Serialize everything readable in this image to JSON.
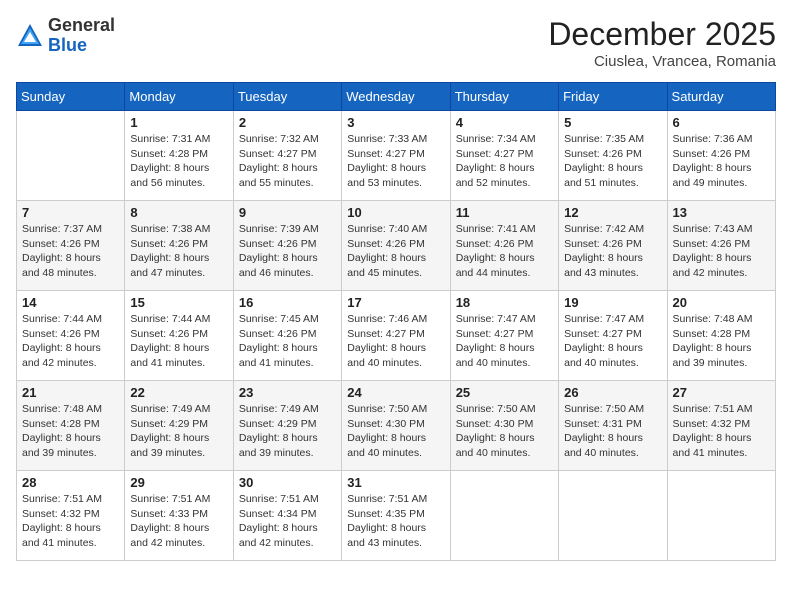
{
  "header": {
    "logo_general": "General",
    "logo_blue": "Blue",
    "month_title": "December 2025",
    "location": "Ciuslea, Vrancea, Romania"
  },
  "weekdays": [
    "Sunday",
    "Monday",
    "Tuesday",
    "Wednesday",
    "Thursday",
    "Friday",
    "Saturday"
  ],
  "weeks": [
    [
      {
        "day": "",
        "info": ""
      },
      {
        "day": "1",
        "info": "Sunrise: 7:31 AM\nSunset: 4:28 PM\nDaylight: 8 hours\nand 56 minutes."
      },
      {
        "day": "2",
        "info": "Sunrise: 7:32 AM\nSunset: 4:27 PM\nDaylight: 8 hours\nand 55 minutes."
      },
      {
        "day": "3",
        "info": "Sunrise: 7:33 AM\nSunset: 4:27 PM\nDaylight: 8 hours\nand 53 minutes."
      },
      {
        "day": "4",
        "info": "Sunrise: 7:34 AM\nSunset: 4:27 PM\nDaylight: 8 hours\nand 52 minutes."
      },
      {
        "day": "5",
        "info": "Sunrise: 7:35 AM\nSunset: 4:26 PM\nDaylight: 8 hours\nand 51 minutes."
      },
      {
        "day": "6",
        "info": "Sunrise: 7:36 AM\nSunset: 4:26 PM\nDaylight: 8 hours\nand 49 minutes."
      }
    ],
    [
      {
        "day": "7",
        "info": "Sunrise: 7:37 AM\nSunset: 4:26 PM\nDaylight: 8 hours\nand 48 minutes."
      },
      {
        "day": "8",
        "info": "Sunrise: 7:38 AM\nSunset: 4:26 PM\nDaylight: 8 hours\nand 47 minutes."
      },
      {
        "day": "9",
        "info": "Sunrise: 7:39 AM\nSunset: 4:26 PM\nDaylight: 8 hours\nand 46 minutes."
      },
      {
        "day": "10",
        "info": "Sunrise: 7:40 AM\nSunset: 4:26 PM\nDaylight: 8 hours\nand 45 minutes."
      },
      {
        "day": "11",
        "info": "Sunrise: 7:41 AM\nSunset: 4:26 PM\nDaylight: 8 hours\nand 44 minutes."
      },
      {
        "day": "12",
        "info": "Sunrise: 7:42 AM\nSunset: 4:26 PM\nDaylight: 8 hours\nand 43 minutes."
      },
      {
        "day": "13",
        "info": "Sunrise: 7:43 AM\nSunset: 4:26 PM\nDaylight: 8 hours\nand 42 minutes."
      }
    ],
    [
      {
        "day": "14",
        "info": "Sunrise: 7:44 AM\nSunset: 4:26 PM\nDaylight: 8 hours\nand 42 minutes."
      },
      {
        "day": "15",
        "info": "Sunrise: 7:44 AM\nSunset: 4:26 PM\nDaylight: 8 hours\nand 41 minutes."
      },
      {
        "day": "16",
        "info": "Sunrise: 7:45 AM\nSunset: 4:26 PM\nDaylight: 8 hours\nand 41 minutes."
      },
      {
        "day": "17",
        "info": "Sunrise: 7:46 AM\nSunset: 4:27 PM\nDaylight: 8 hours\nand 40 minutes."
      },
      {
        "day": "18",
        "info": "Sunrise: 7:47 AM\nSunset: 4:27 PM\nDaylight: 8 hours\nand 40 minutes."
      },
      {
        "day": "19",
        "info": "Sunrise: 7:47 AM\nSunset: 4:27 PM\nDaylight: 8 hours\nand 40 minutes."
      },
      {
        "day": "20",
        "info": "Sunrise: 7:48 AM\nSunset: 4:28 PM\nDaylight: 8 hours\nand 39 minutes."
      }
    ],
    [
      {
        "day": "21",
        "info": "Sunrise: 7:48 AM\nSunset: 4:28 PM\nDaylight: 8 hours\nand 39 minutes."
      },
      {
        "day": "22",
        "info": "Sunrise: 7:49 AM\nSunset: 4:29 PM\nDaylight: 8 hours\nand 39 minutes."
      },
      {
        "day": "23",
        "info": "Sunrise: 7:49 AM\nSunset: 4:29 PM\nDaylight: 8 hours\nand 39 minutes."
      },
      {
        "day": "24",
        "info": "Sunrise: 7:50 AM\nSunset: 4:30 PM\nDaylight: 8 hours\nand 40 minutes."
      },
      {
        "day": "25",
        "info": "Sunrise: 7:50 AM\nSunset: 4:30 PM\nDaylight: 8 hours\nand 40 minutes."
      },
      {
        "day": "26",
        "info": "Sunrise: 7:50 AM\nSunset: 4:31 PM\nDaylight: 8 hours\nand 40 minutes."
      },
      {
        "day": "27",
        "info": "Sunrise: 7:51 AM\nSunset: 4:32 PM\nDaylight: 8 hours\nand 41 minutes."
      }
    ],
    [
      {
        "day": "28",
        "info": "Sunrise: 7:51 AM\nSunset: 4:32 PM\nDaylight: 8 hours\nand 41 minutes."
      },
      {
        "day": "29",
        "info": "Sunrise: 7:51 AM\nSunset: 4:33 PM\nDaylight: 8 hours\nand 42 minutes."
      },
      {
        "day": "30",
        "info": "Sunrise: 7:51 AM\nSunset: 4:34 PM\nDaylight: 8 hours\nand 42 minutes."
      },
      {
        "day": "31",
        "info": "Sunrise: 7:51 AM\nSunset: 4:35 PM\nDaylight: 8 hours\nand 43 minutes."
      },
      {
        "day": "",
        "info": ""
      },
      {
        "day": "",
        "info": ""
      },
      {
        "day": "",
        "info": ""
      }
    ]
  ]
}
